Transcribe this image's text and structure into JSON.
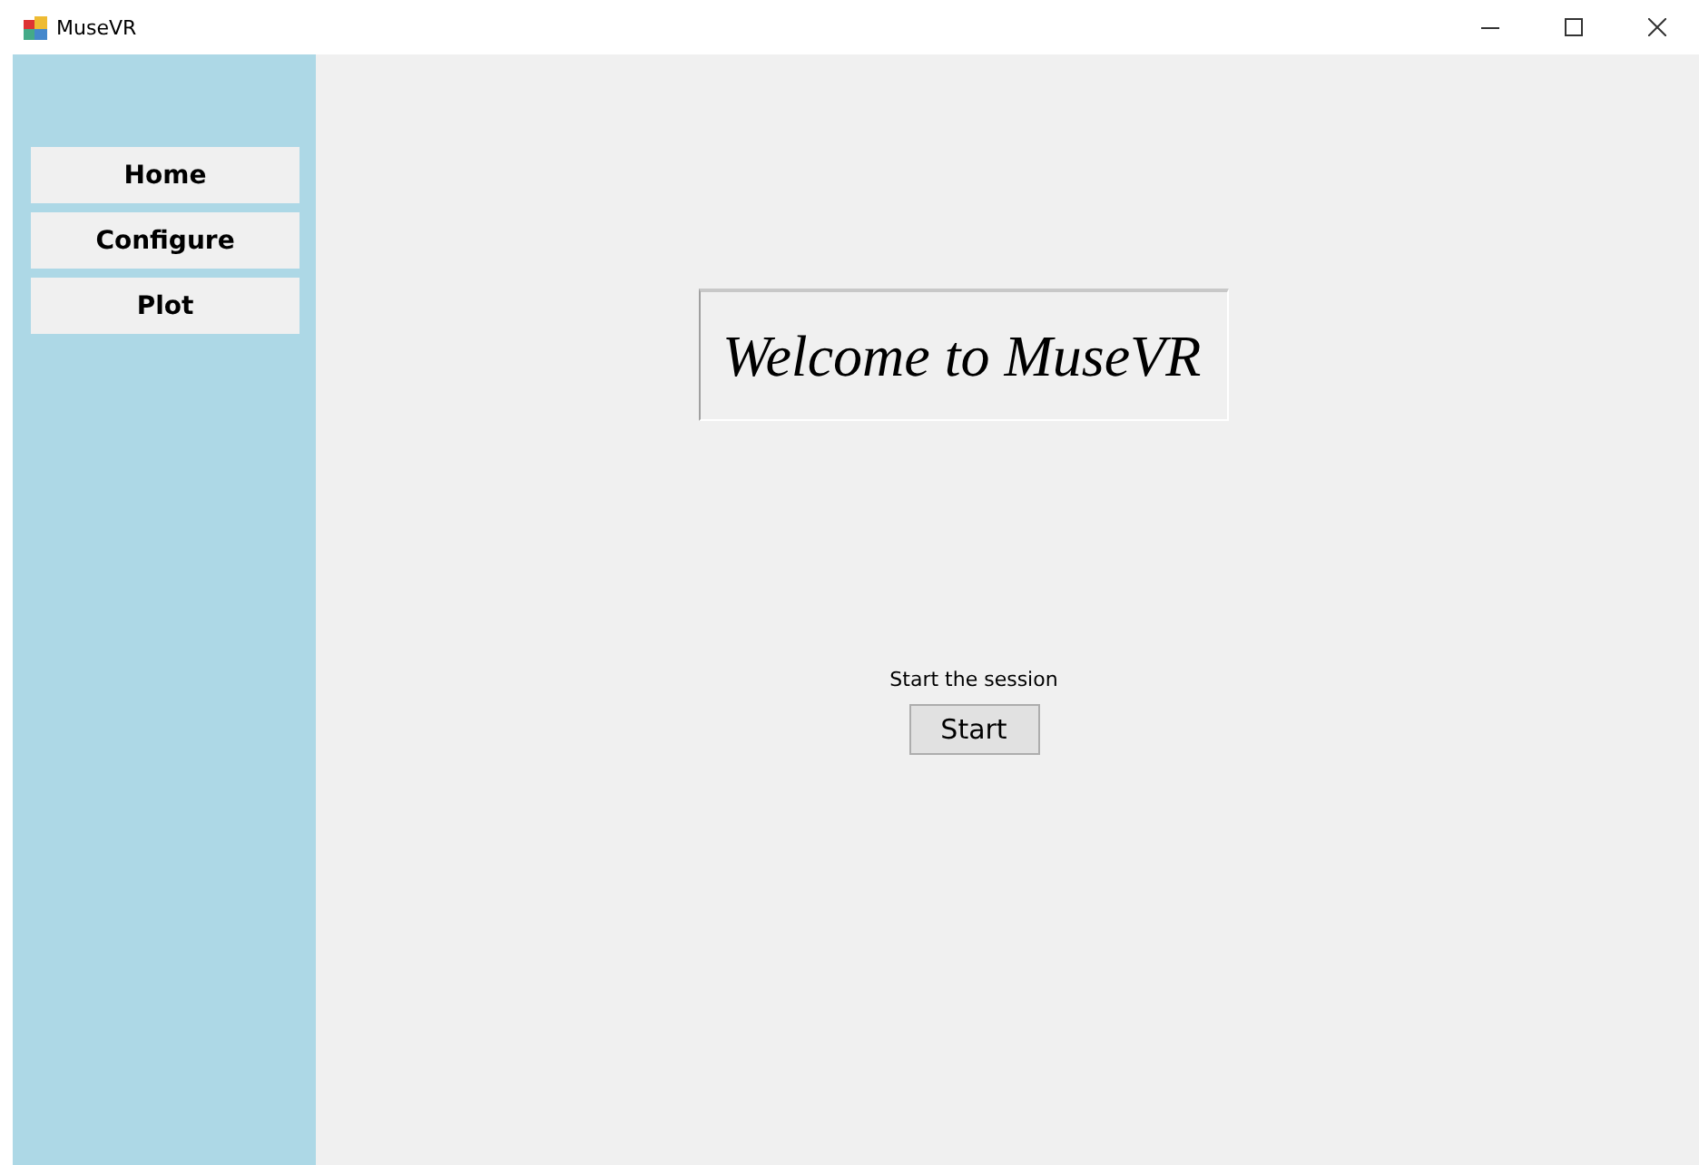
{
  "window": {
    "title": "MuseVR"
  },
  "sidebar": {
    "buttons": [
      {
        "label": "Home"
      },
      {
        "label": "Configure"
      },
      {
        "label": "Plot"
      }
    ]
  },
  "welcome": {
    "heading": "Welcome to MuseVR"
  },
  "session": {
    "prompt": "Start the session",
    "button": "Start"
  }
}
